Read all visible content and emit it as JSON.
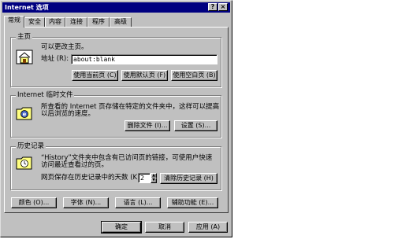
{
  "window": {
    "title": "Internet 选项",
    "help_glyph": "?",
    "close_glyph": "×"
  },
  "tabs": [
    {
      "label": "常规"
    },
    {
      "label": "安全"
    },
    {
      "label": "内容"
    },
    {
      "label": "连接"
    },
    {
      "label": "程序"
    },
    {
      "label": "高级"
    }
  ],
  "home": {
    "group_label": "主页",
    "description": "可以更改主页。",
    "address_label": "地址 (R):",
    "address_value": "about:blank",
    "btn_current": "使用当前页 (C)",
    "btn_default": "使用默认页 (F)",
    "btn_blank": "使用空白页 (B)"
  },
  "temp": {
    "group_label": "Internet 临时文件",
    "desc_line1": "所查看的 Internet 页存储在特定的文件夹中，这样可以提高",
    "desc_line2": "以后浏览的速度。",
    "btn_delete": "删除文件 (I)...",
    "btn_settings": "设置 (S)..."
  },
  "history": {
    "group_label": "历史记录",
    "desc_line1": "“History”文件夹中包含有已访问页的链接，可使用户快速",
    "desc_line2": "访问最近查看过的页。",
    "days_label": "网页保存在历史记录中的天数 (K):",
    "days_value": "2",
    "btn_clear": "清除历史记录 (H)"
  },
  "bottom_row": {
    "colors": "颜色 (O)...",
    "fonts": "字体 (N)...",
    "languages": "语言 (L)...",
    "accessibility": "辅助功能 (E)..."
  },
  "footer": {
    "ok": "确定",
    "cancel": "取消",
    "apply": "应用 (A)"
  }
}
